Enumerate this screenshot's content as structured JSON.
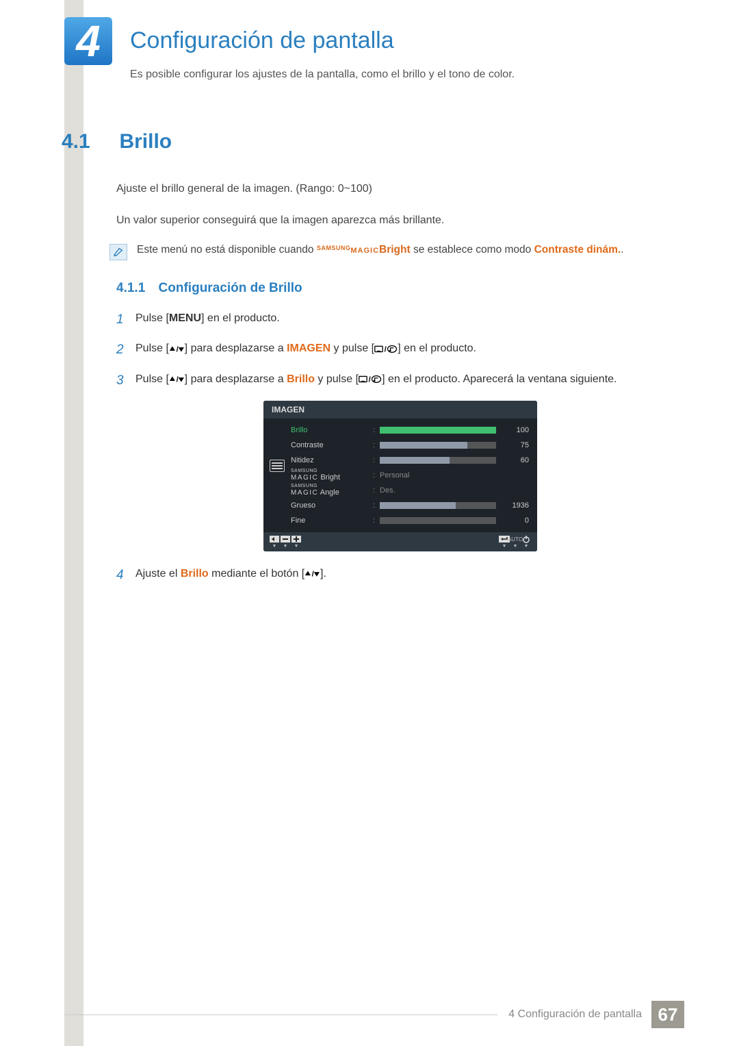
{
  "chapter": {
    "number": "4",
    "title": "Configuración de pantalla",
    "subtitle": "Es posible configurar los ajustes de la pantalla, como el brillo y el tono de color."
  },
  "section": {
    "number": "4.1",
    "title": "Brillo",
    "para1": "Ajuste el brillo general de la imagen. (Rango: 0~100)",
    "para2": "Un valor superior conseguirá que la imagen aparezca más brillante.",
    "note": {
      "pre": "Este menú no está disponible cuando ",
      "samsung_sup": "SAMSUNG",
      "magic": "MAGIC",
      "bright": "Bright",
      "mid": " se establece como modo ",
      "dyn": "Contraste dinám.",
      "post": "."
    }
  },
  "subsection": {
    "number": "4.1.1",
    "title": "Configuración de Brillo"
  },
  "steps": {
    "s1": {
      "n": "1",
      "a": "Pulse [",
      "menu": "MENU",
      "b": "] en el producto."
    },
    "s2": {
      "n": "2",
      "a": "Pulse [",
      "b": "] para desplazarse a ",
      "imagen": "IMAGEN",
      "c": " y pulse [",
      "d": "] en el producto."
    },
    "s3": {
      "n": "3",
      "a": "Pulse [",
      "b": "] para desplazarse a ",
      "brillo": "Brillo",
      "c": " y pulse [",
      "d": "] en el producto. Aparecerá la ventana siguiente."
    },
    "s4": {
      "n": "4",
      "a": "Ajuste el ",
      "brillo": "Brillo",
      "b": " mediante el botón [",
      "c": "]."
    }
  },
  "osd": {
    "title": "IMAGEN",
    "rows": [
      {
        "label": "Brillo",
        "value": "100",
        "fill": 100,
        "selected": true,
        "type": "bar"
      },
      {
        "label": "Contraste",
        "value": "75",
        "fill": 75,
        "type": "bar"
      },
      {
        "label": "Nitidez",
        "value": "60",
        "fill": 60,
        "type": "bar"
      },
      {
        "label_sup": "SAMSUNG",
        "label_magic": "MAGIC",
        "label_tail": " Bright",
        "text": "Personal",
        "type": "text"
      },
      {
        "label_sup": "SAMSUNG",
        "label_magic": "MAGIC",
        "label_tail": " Angle",
        "text": "Des.",
        "type": "text"
      },
      {
        "label": "Grueso",
        "value": "1936",
        "fill": 65,
        "type": "bar"
      },
      {
        "label": "Fine",
        "value": "0",
        "fill": 0,
        "type": "bar"
      }
    ],
    "auto": "AUTO"
  },
  "footer": {
    "text": "4 Configuración de pantalla",
    "page": "67"
  }
}
